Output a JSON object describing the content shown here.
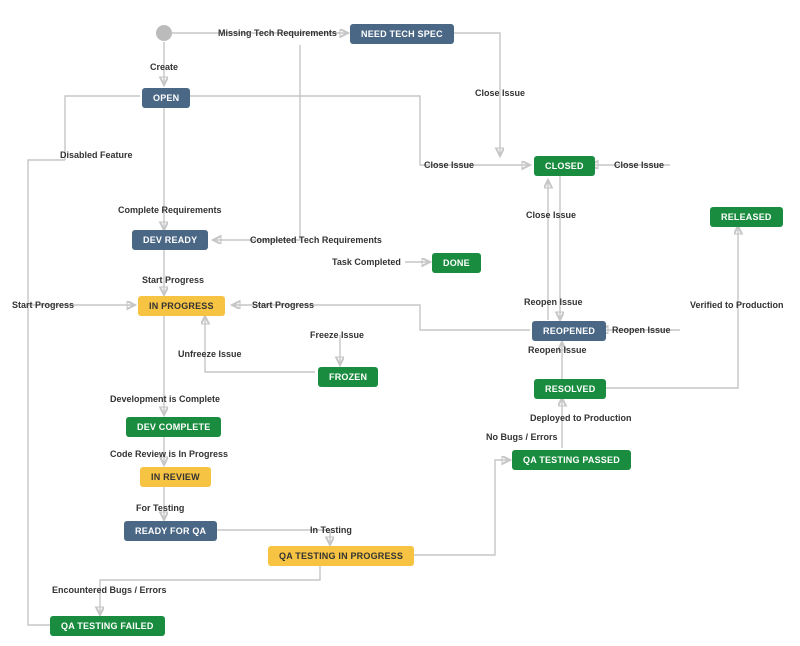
{
  "nodes": {
    "open": "OPEN",
    "need_tech_spec": "NEED TECH SPEC",
    "dev_ready": "DEV READY",
    "closed": "CLOSED",
    "released": "RELEASED",
    "done": "DONE",
    "in_progress": "IN PROGRESS",
    "reopened": "REOPENED",
    "frozen": "FROZEN",
    "resolved": "RESOLVED",
    "dev_complete": "DEV COMPLETE",
    "in_review": "IN REVIEW",
    "qa_testing_passed": "QA TESTING PASSED",
    "ready_for_qa": "READY FOR QA",
    "qa_testing_in_progress": "QA TESTING IN PROGRESS",
    "qa_testing_failed": "QA TESTING FAILED"
  },
  "edges": {
    "create": "Create",
    "missing_tech_req": "Missing Tech Requirements",
    "close_issue_1": "Close Issue",
    "close_issue_2": "Close Issue",
    "close_issue_3": "Close Issue",
    "close_issue_4": "Close Issue",
    "disabled_feature": "Disabled Feature",
    "complete_req": "Complete Requirements",
    "completed_tech_req": "Completed Tech Requirements",
    "task_completed": "Task Completed",
    "start_progress_1": "Start Progress",
    "start_progress_2": "Start Progress",
    "start_progress_3": "Start Progress",
    "reopen_issue_1": "Reopen Issue",
    "reopen_issue_2": "Reopen Issue",
    "reopen_issue_3": "Reopen Issue",
    "verified_prod": "Verified to Production",
    "freeze_issue": "Freeze Issue",
    "unfreeze_issue": "Unfreeze Issue",
    "dev_is_complete": "Development is Complete",
    "code_review": "Code Review is In Progress",
    "deployed_prod": "Deployed to Production",
    "no_bugs": "No Bugs / Errors",
    "for_testing": "For Testing",
    "in_testing": "In Testing",
    "encountered_bugs": "Encountered Bugs / Errors"
  }
}
